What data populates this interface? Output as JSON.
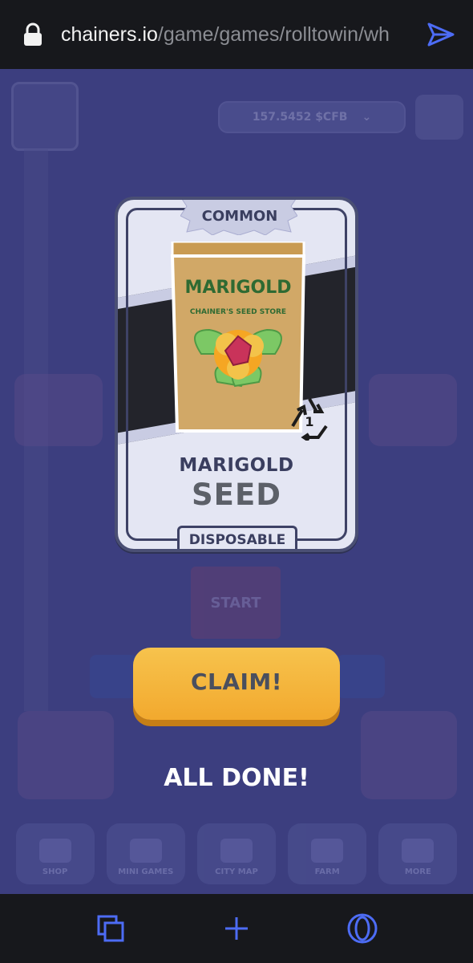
{
  "browser": {
    "url_host": "chainers.io",
    "url_path": "/game/games/rolltowin/wh",
    "lock_icon": "lock-icon",
    "send_icon": "send-icon"
  },
  "background": {
    "balance": "157.5452 $CFB",
    "start_label": "START",
    "nav_tabs": [
      {
        "label": "SHOP"
      },
      {
        "label": "MINI GAMES"
      },
      {
        "label": "CITY MAP"
      },
      {
        "label": "FARM"
      },
      {
        "label": "MORE"
      }
    ]
  },
  "card": {
    "rarity": "COMMON",
    "bag_title": "MARIGOLD",
    "bag_subtitle": "CHAINER'S SEED STORE",
    "count_badge": "1",
    "name": "MARIGOLD",
    "type": "SEED",
    "tag": "DISPOSABLE"
  },
  "actions": {
    "claim_label": "CLAIM!",
    "status": "ALL DONE!"
  },
  "colors": {
    "game_bg": "#3c3e7f",
    "claim_button": "#f3b23a",
    "browser_accent": "#4d6cf5"
  }
}
